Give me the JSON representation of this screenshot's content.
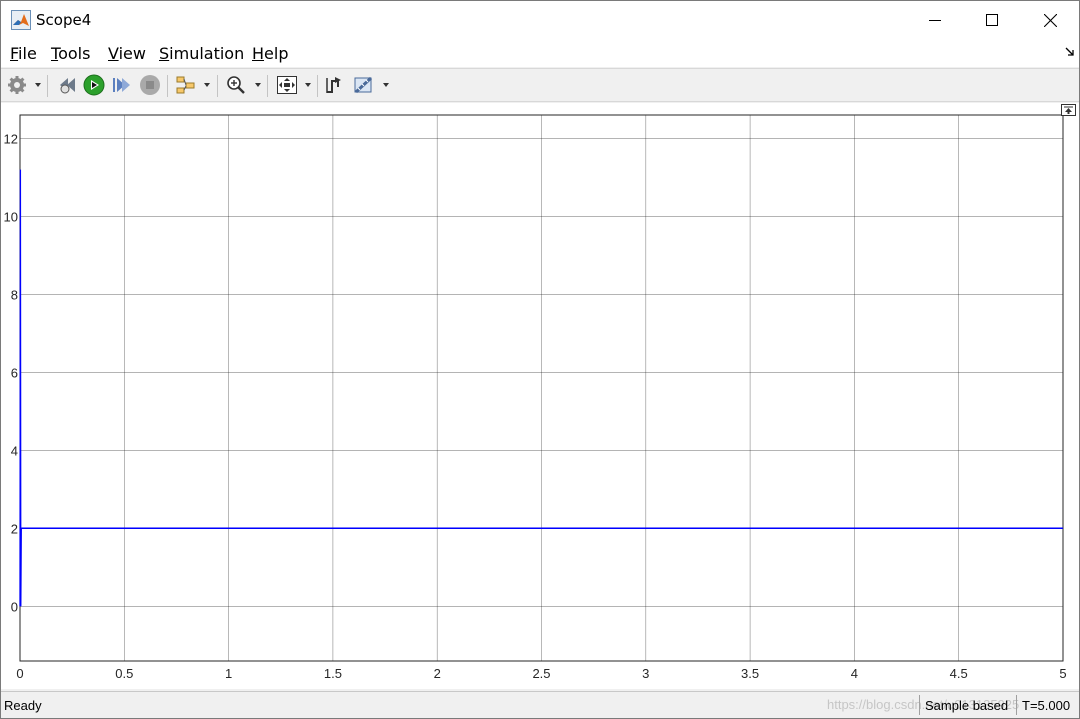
{
  "window": {
    "title": "Scope4"
  },
  "menu": [
    {
      "label": "File",
      "accel": "F",
      "rest": "ile"
    },
    {
      "label": "Tools",
      "accel": "T",
      "rest": "ools"
    },
    {
      "label": "View",
      "accel": "V",
      "rest": "iew"
    },
    {
      "label": "Simulation",
      "accel": "S",
      "rest": "imulation"
    },
    {
      "label": "Help",
      "accel": "H",
      "rest": "elp"
    }
  ],
  "toolbar": {
    "icons": [
      "settings-icon",
      "step-back-icon",
      "run-icon",
      "step-forward-icon",
      "stop-icon",
      "signal-selector-icon",
      "zoom-icon",
      "autoscale-icon",
      "triggers-icon",
      "measurements-icon"
    ]
  },
  "colors": {
    "signal": "#0000ff",
    "grid": "#262626",
    "run_green": "#2ca02c"
  },
  "status": {
    "left": "Ready",
    "mode": "Sample based",
    "time": "T=5.000",
    "watermark": "https://blog.csdn.net/u013135925"
  },
  "chart_data": {
    "type": "line",
    "xlim": [
      0,
      5
    ],
    "ylim": [
      -1.4,
      12.6
    ],
    "x_ticks": [
      "0",
      "0.5",
      "1",
      "1.5",
      "2",
      "2.5",
      "3",
      "3.5",
      "4",
      "4.5",
      "5"
    ],
    "x_tick_values": [
      0,
      0.5,
      1,
      1.5,
      2,
      2.5,
      3,
      3.5,
      4,
      4.5,
      5
    ],
    "y_ticks": [
      "0",
      "2",
      "4",
      "6",
      "8",
      "10",
      "12"
    ],
    "y_tick_values": [
      0,
      2,
      4,
      6,
      8,
      10,
      12
    ],
    "grid": true,
    "series": [
      {
        "x": [
          0,
          0.002,
          0.004,
          0.006,
          0.01,
          5
        ],
        "y": [
          0,
          11.2,
          0,
          2.0,
          2.0,
          2.0
        ]
      }
    ]
  }
}
